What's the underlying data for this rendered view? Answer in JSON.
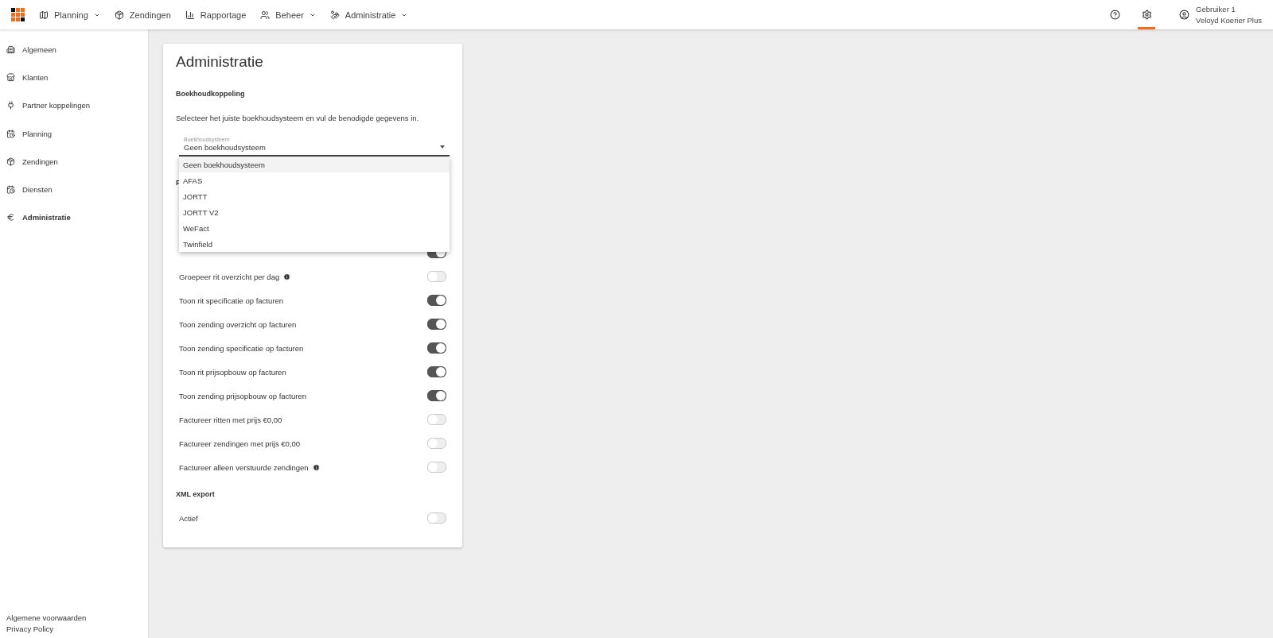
{
  "topbar": {
    "nav": [
      {
        "label": "Planning",
        "dropdown": true
      },
      {
        "label": "Zendingen",
        "dropdown": false
      },
      {
        "label": "Rapportage",
        "dropdown": false
      },
      {
        "label": "Beheer",
        "dropdown": true
      },
      {
        "label": "Administratie",
        "dropdown": true
      }
    ],
    "tools": [
      {
        "kind": "help",
        "selected": false
      },
      {
        "kind": "settings",
        "selected": true
      }
    ],
    "user": {
      "name": "Gebruiker 1",
      "company": "Veloyd Koerier Plus"
    }
  },
  "sidebar": {
    "items": [
      {
        "label": "Algemeen",
        "selected": false
      },
      {
        "label": "Klanten",
        "selected": false
      },
      {
        "label": "Partner koppelingen",
        "selected": false
      },
      {
        "label": "Planning",
        "selected": false
      },
      {
        "label": "Zendingen",
        "selected": false
      },
      {
        "label": "Diensten",
        "selected": false
      },
      {
        "label": "Administratie",
        "selected": true
      }
    ],
    "footer_links": [
      "Algemene voorwaarden",
      "Privacy Policy"
    ]
  },
  "card": {
    "title": "Administratie",
    "section": "Boekhoudkoppeling",
    "description": "Selecteer het juiste boekhoudsysteem en vul de benodigde gegevens in.",
    "select": {
      "label": "Boekhoudsysteem",
      "value": "Geen boekhoudsysteem",
      "expanded": true,
      "options": [
        {
          "label": "Geen boekhoudsysteem",
          "selected": true
        },
        {
          "label": "AFAS",
          "selected": false
        },
        {
          "label": "JORTT",
          "selected": false
        },
        {
          "label": "JORTT V2",
          "selected": false
        },
        {
          "label": "WeFact",
          "selected": false
        },
        {
          "label": "Twinfield",
          "selected": false
        }
      ]
    },
    "covered_heading": "F",
    "settings": [
      {
        "on": true
      },
      {
        "label": "Groepeer rit overzicht per dag",
        "on": false,
        "info": true
      },
      {
        "label": "Toon rit specificatie op facturen",
        "on": true,
        "info": false
      },
      {
        "label": "Toon zending overzicht op facturen",
        "on": true,
        "info": false
      },
      {
        "label": "Toon zending specificatie op facturen",
        "on": true,
        "info": false
      },
      {
        "label": "Toon rit prijsopbouw op facturen",
        "on": true,
        "info": false
      },
      {
        "label": "Toon zending prijsopbouw op facturen",
        "on": true,
        "info": false
      },
      {
        "label": "Factureer ritten met prijs €0,00",
        "on": false,
        "info": false
      },
      {
        "label": "Factureer zendingen met prijs €0,00",
        "on": false,
        "info": false
      },
      {
        "label": "Factureer alleen verstuurde zendingen",
        "on": false,
        "info": true
      }
    ],
    "xml_section": "XML export",
    "xml_settings": [
      {
        "label": "Actief",
        "on": false,
        "info": false
      }
    ]
  }
}
